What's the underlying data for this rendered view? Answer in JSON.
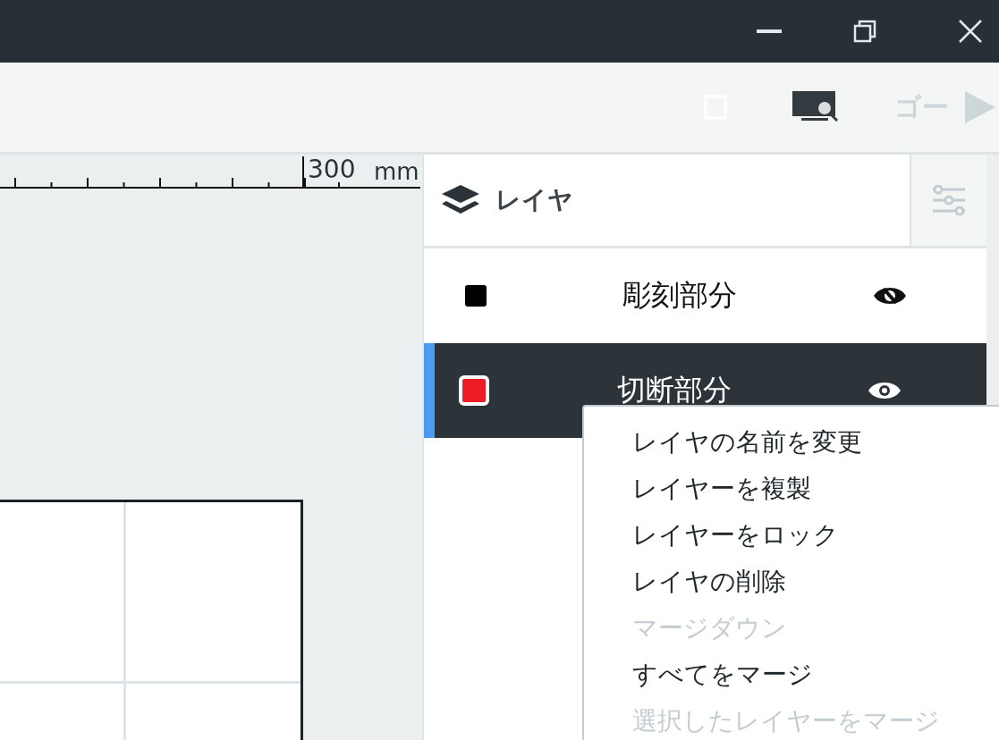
{
  "toolbar": {
    "go_button": {
      "label": "ゴー",
      "disabled": true
    }
  },
  "ruler": {
    "label": "300",
    "unit": "mm"
  },
  "layers_panel": {
    "title": "レイヤ",
    "layers": [
      {
        "name": "彫刻部分",
        "color": "#000000",
        "visible": false,
        "selected": false
      },
      {
        "name": "切断部分",
        "color": "#ee1c24",
        "visible": true,
        "selected": true
      }
    ]
  },
  "context_menu": {
    "items": [
      {
        "label": "レイヤの名前を変更",
        "disabled": false
      },
      {
        "label": "レイヤーを複製",
        "disabled": false
      },
      {
        "label": "レイヤーをロック",
        "disabled": false
      },
      {
        "label": "レイヤの削除",
        "disabled": false
      },
      {
        "label": "マージダウン",
        "disabled": true
      },
      {
        "label": "すべてをマージ",
        "disabled": false
      },
      {
        "label": "選択したレイヤーをマージ",
        "disabled": true
      }
    ]
  }
}
